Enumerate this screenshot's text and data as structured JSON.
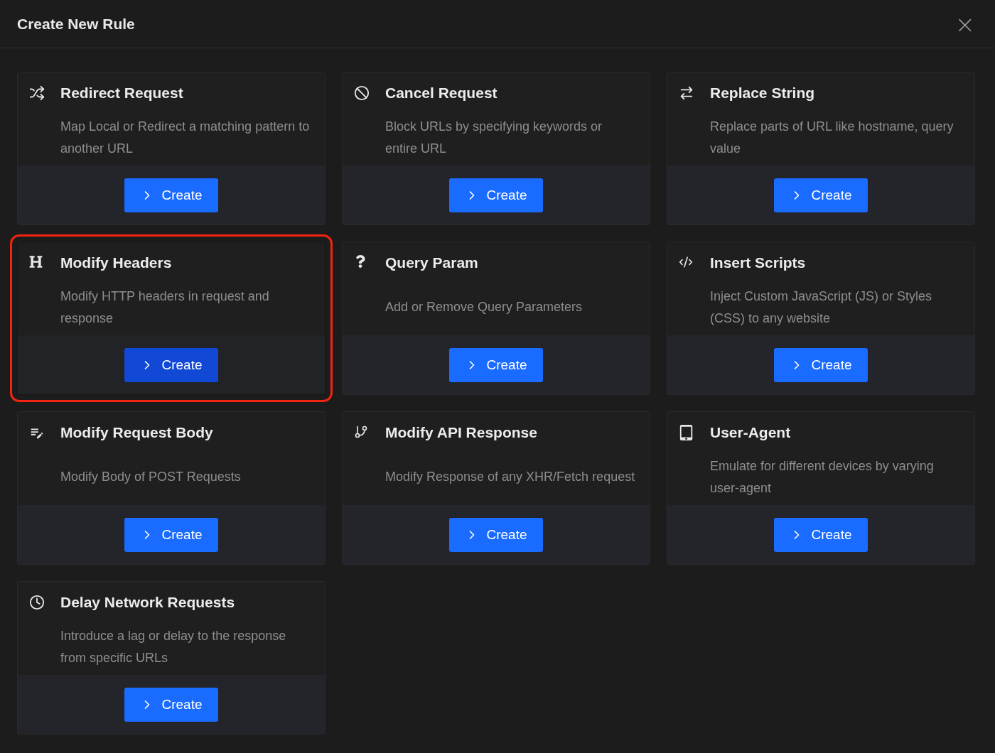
{
  "dialog": {
    "title": "Create New Rule",
    "close_label": "×"
  },
  "rules": [
    {
      "title": "Redirect Request",
      "description": "Map Local or Redirect a matching pattern to another URL",
      "button": "Create",
      "selected": false
    },
    {
      "title": "Cancel Request",
      "description": "Block URLs by specifying keywords or entire URL",
      "button": "Create",
      "selected": false
    },
    {
      "title": "Replace String",
      "description": "Replace parts of URL like hostname, query value",
      "button": "Create",
      "selected": false
    },
    {
      "title": "Modify Headers",
      "description": "Modify HTTP headers in request and response",
      "button": "Create",
      "selected": true
    },
    {
      "title": "Query Param",
      "description": "Add or Remove Query Parameters",
      "button": "Create",
      "selected": false
    },
    {
      "title": "Insert Scripts",
      "description": "Inject Custom JavaScript (JS) or Styles (CSS) to any website",
      "button": "Create",
      "selected": false
    },
    {
      "title": "Modify Request Body",
      "description": "Modify Body of POST Requests",
      "button": "Create",
      "selected": false
    },
    {
      "title": "Modify API Response",
      "description": "Modify Response of any XHR/Fetch request",
      "button": "Create",
      "selected": false
    },
    {
      "title": "User-Agent",
      "description": "Emulate for different devices by varying user-agent",
      "button": "Create",
      "selected": false
    },
    {
      "title": "Delay Network Requests",
      "description": "Introduce a lag or delay to the response from specific URLs",
      "button": "Create",
      "selected": false
    }
  ]
}
